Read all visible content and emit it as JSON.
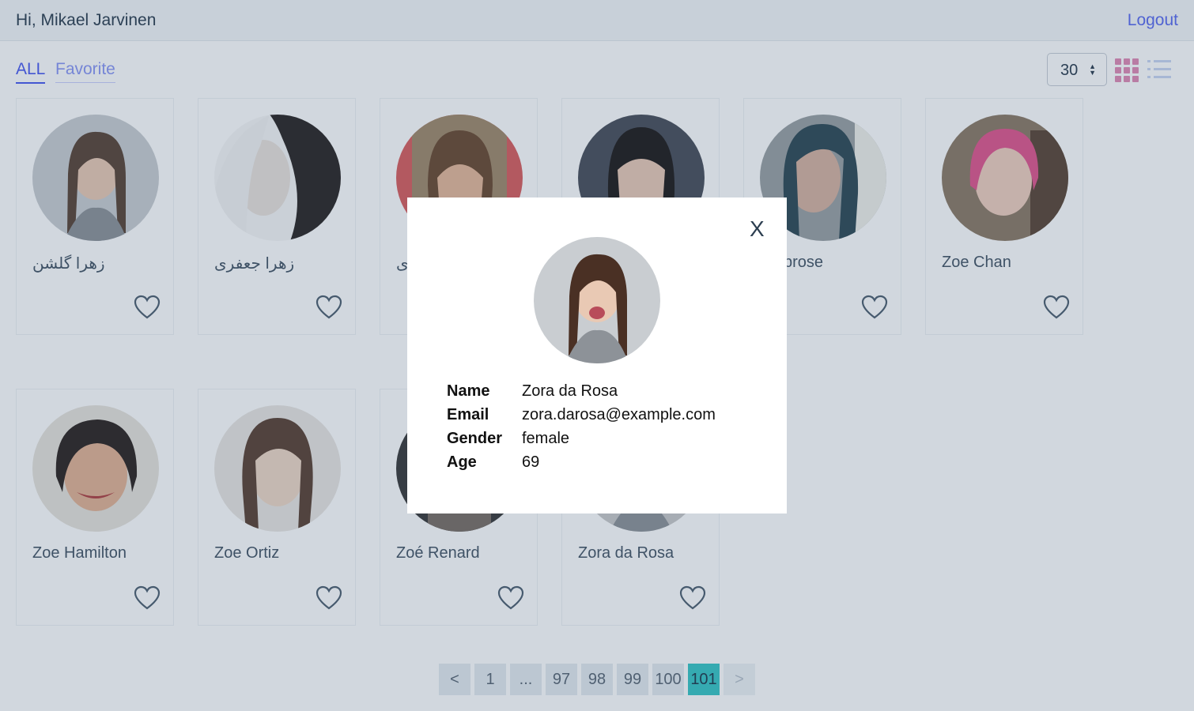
{
  "header": {
    "greeting": "Hi, Mikael Jarvinen",
    "logout_label": "Logout"
  },
  "filters": {
    "all_label": "ALL",
    "favorite_label": "Favorite"
  },
  "controls": {
    "per_page": "30",
    "view_mode": "grid"
  },
  "cards": [
    {
      "name": "زهرا گلشن",
      "favorite": false
    },
    {
      "name": "زهرا جعفری",
      "favorite": false
    },
    {
      "name": "ی",
      "favorite": false
    },
    {
      "name": "",
      "favorite": false
    },
    {
      "name": "Ambrose",
      "favorite": false
    },
    {
      "name": "Zoe Chan",
      "favorite": false
    },
    {
      "name": "Zoe Hamilton",
      "favorite": false
    },
    {
      "name": "Zoe Ortiz",
      "favorite": false
    },
    {
      "name": "Zoé Renard",
      "favorite": false
    },
    {
      "name": "Zora da Rosa",
      "favorite": false
    }
  ],
  "pagination": {
    "prev": "<",
    "first": "1",
    "ellipsis": "...",
    "p97": "97",
    "p98": "98",
    "p99": "99",
    "p100": "100",
    "p101": "101",
    "next": ">",
    "current": "101"
  },
  "modal": {
    "close_label": "X",
    "name_label": "Name",
    "name_value": "Zora da Rosa",
    "email_label": "Email",
    "email_value": "zora.darosa@example.com",
    "gender_label": "Gender",
    "gender_value": "female",
    "age_label": "Age",
    "age_value": "69"
  },
  "colors": {
    "accent": "#4a5af0",
    "active_page": "#38c6c6",
    "grid_icon": "#e08bb5"
  }
}
